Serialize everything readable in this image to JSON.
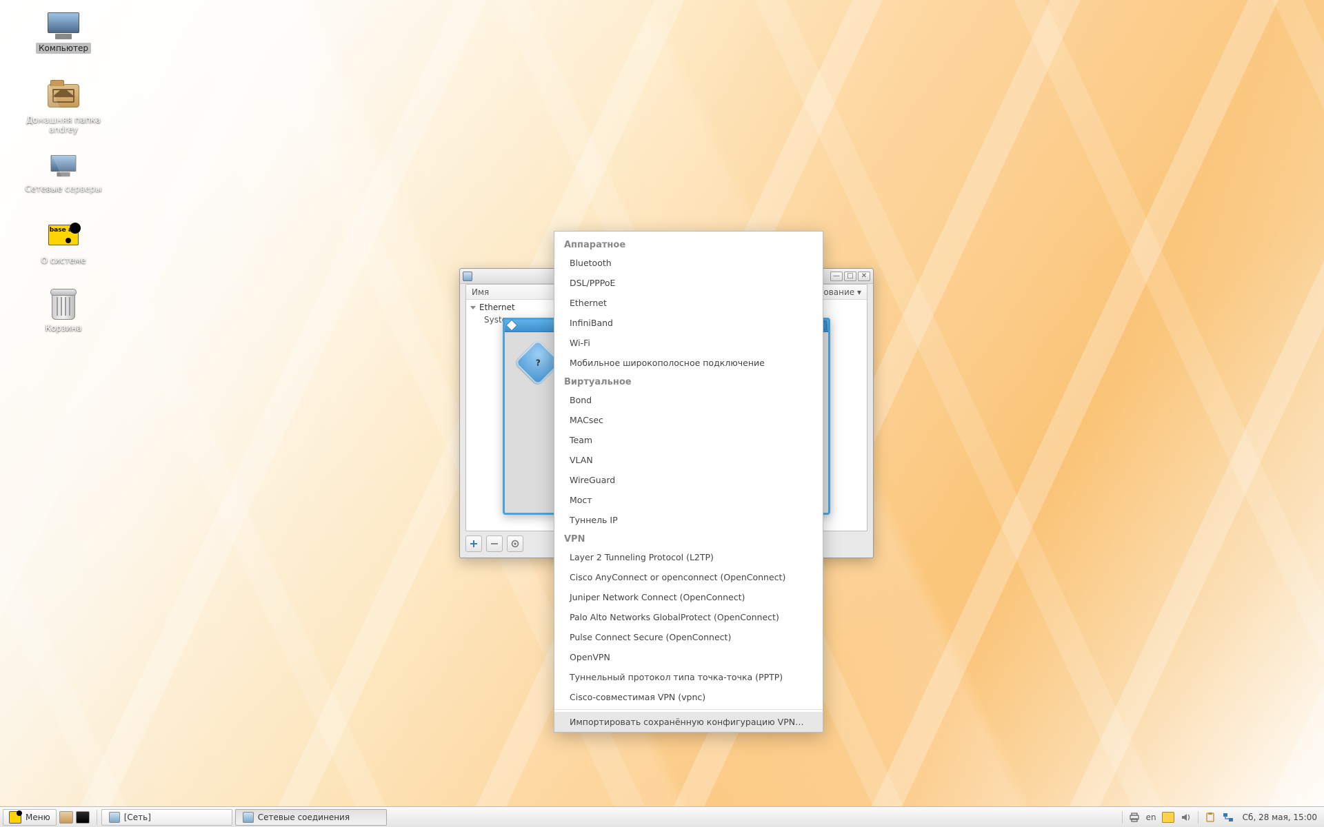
{
  "desktop_icons": {
    "computer": "Компьютер",
    "home": "Домашняя папка andrey",
    "servers": "Сетевые серверы",
    "about": "О системе",
    "about_glyph": "base alt",
    "trash": "Корзина"
  },
  "window": {
    "header_name": "Имя",
    "header_used": "…ование ▾",
    "group": "Ethernet",
    "item": "System",
    "close_glyph": "✕",
    "max_glyph": "□",
    "min_glyph": "—"
  },
  "dialog": {
    "close_glyph": "✕"
  },
  "menu": {
    "section_hw": "Аппаратное",
    "hw": [
      "Bluetooth",
      "DSL/PPPoE",
      "Ethernet",
      "InfiniBand",
      "Wi-Fi",
      "Мобильное широкополосное подключение"
    ],
    "section_virt": "Виртуальное",
    "virt": [
      "Bond",
      "MACsec",
      "Team",
      "VLAN",
      "WireGuard",
      "Мост",
      "Туннель IP"
    ],
    "section_vpn": "VPN",
    "vpn": [
      "Layer 2 Tunneling Protocol (L2TP)",
      "Cisco AnyConnect or openconnect (OpenConnect)",
      "Juniper Network Connect (OpenConnect)",
      "Palo Alto Networks GlobalProtect (OpenConnect)",
      "Pulse Connect Secure (OpenConnect)",
      "OpenVPN",
      "Туннельный протокол типа точка-точка (PPTP)",
      "Cisco-совместимая VPN (vpnc)"
    ],
    "import": "Импортировать сохранённую конфигурацию VPN…"
  },
  "taskbar": {
    "menu": "Меню",
    "task_network": "[Сеть]",
    "task_connections": "Сетевые соединения",
    "lang": "en",
    "clock": "Сб, 28 мая, 15:00"
  }
}
